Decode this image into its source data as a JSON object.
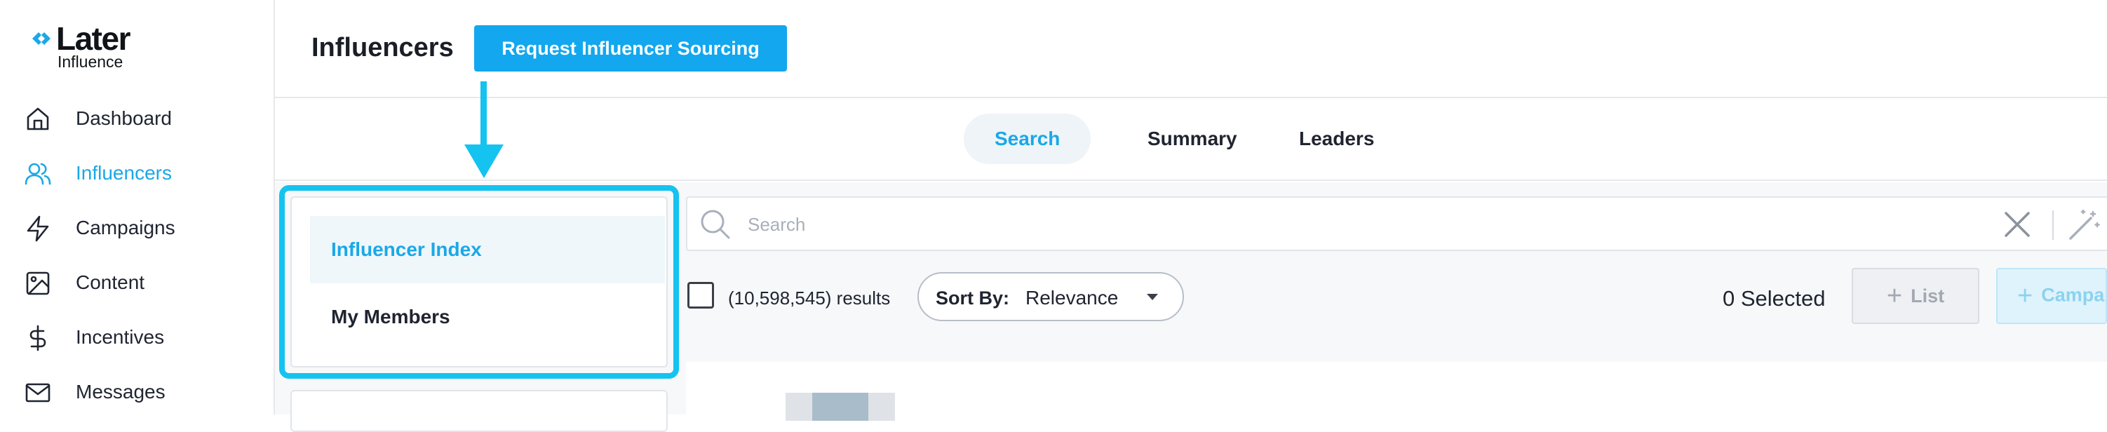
{
  "brand": {
    "name": "Later",
    "sub": "Influence",
    "accent": "#1aa8e8",
    "highlight": "#14c3f0"
  },
  "sidebar": {
    "items": [
      {
        "label": "Dashboard",
        "icon": "home-icon"
      },
      {
        "label": "Influencers",
        "icon": "users-icon",
        "active": true
      },
      {
        "label": "Campaigns",
        "icon": "lightning-icon"
      },
      {
        "label": "Content",
        "icon": "image-icon"
      },
      {
        "label": "Incentives",
        "icon": "dollar-icon"
      },
      {
        "label": "Messages",
        "icon": "mail-icon"
      }
    ]
  },
  "header": {
    "title": "Influencers",
    "request_button": "Request Influencer Sourcing"
  },
  "tabs": [
    {
      "label": "Search",
      "active": true
    },
    {
      "label": "Summary"
    },
    {
      "label": "Leaders"
    }
  ],
  "filters": {
    "items": [
      {
        "label": "Influencer Index",
        "active": true
      },
      {
        "label": "My Members"
      }
    ]
  },
  "search": {
    "placeholder": "Search",
    "value": ""
  },
  "results": {
    "count_text": "(10,598,545) results",
    "sort_label": "Sort By:",
    "sort_value": "Relevance",
    "selected_text": "0 Selected",
    "list_button": "List",
    "campaign_button": "Campaign"
  }
}
